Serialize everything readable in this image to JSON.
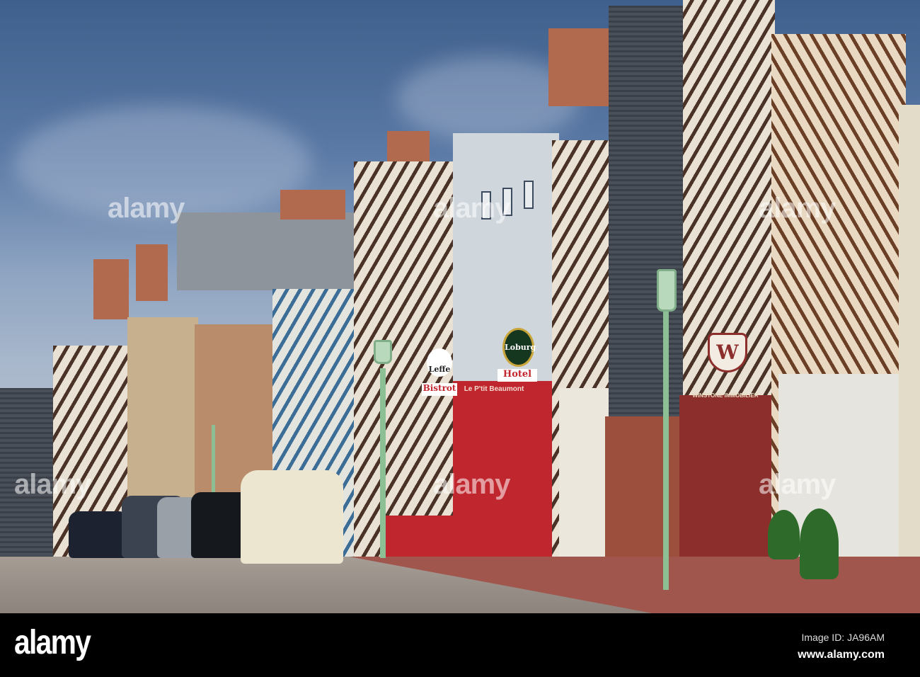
{
  "signs": {
    "leffe": "Leffe",
    "bistrot": "Bistrot",
    "loburg": "Loburg",
    "hotel": "Hotel",
    "restaurant": "Le P'tit Beaumont",
    "agency": "WINSTONE IMMOBILIER",
    "agency_crest": "W"
  },
  "watermark": "alamy",
  "footer": {
    "logo": "alamy",
    "image_id": "Image ID: JA96AM",
    "url": "www.alamy.com"
  }
}
